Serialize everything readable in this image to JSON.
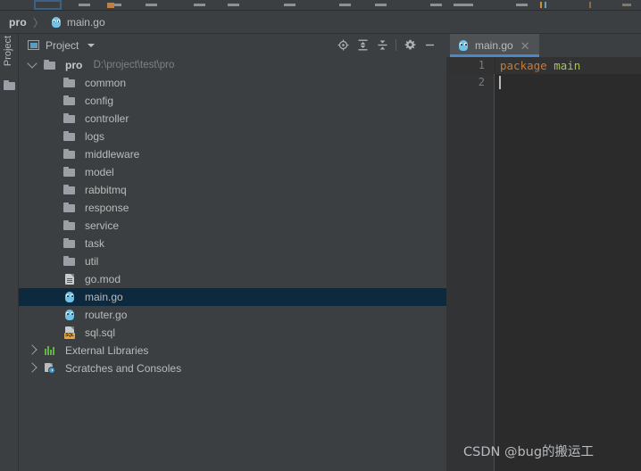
{
  "toolbar_strip": {
    "name": "cut-off-main-toolbar",
    "icon_positions": [
      5,
      40,
      75,
      110,
      145,
      180,
      215,
      250,
      285,
      320,
      355,
      390,
      425,
      460,
      495,
      530,
      565,
      600,
      635,
      670
    ],
    "accent_color": "#3d6185"
  },
  "breadcrumb": {
    "project": "pro",
    "separator": "〉",
    "file": "main.go",
    "file_icon": "go-gopher-icon"
  },
  "tool_strip": {
    "project_label": "Project",
    "folder_icon": "folder-icon"
  },
  "project_panel": {
    "header": {
      "icon": "project-view-icon",
      "title": "Project",
      "caret": "chevron-down-icon",
      "tools": [
        {
          "name": "select-opened-file-button",
          "icon": "crosshair-target-icon"
        },
        {
          "name": "expand-all-button",
          "icon": "expand-all-icon"
        },
        {
          "name": "collapse-all-button",
          "icon": "collapse-all-icon"
        },
        {
          "name": "settings-button",
          "icon": "gear-icon"
        },
        {
          "name": "hide-panel-button",
          "icon": "minimize-icon"
        }
      ]
    },
    "tree": [
      {
        "label": "pro",
        "path": "D:\\project\\test\\pro",
        "icon": "folder-icon",
        "indent": 0,
        "chevron": "down",
        "bold": true,
        "selected": false
      },
      {
        "label": "common",
        "path": "",
        "icon": "folder-icon",
        "indent": 1,
        "chevron": "",
        "bold": false,
        "selected": false
      },
      {
        "label": "config",
        "path": "",
        "icon": "folder-icon",
        "indent": 1,
        "chevron": "",
        "bold": false,
        "selected": false
      },
      {
        "label": "controller",
        "path": "",
        "icon": "folder-icon",
        "indent": 1,
        "chevron": "",
        "bold": false,
        "selected": false
      },
      {
        "label": "logs",
        "path": "",
        "icon": "folder-icon",
        "indent": 1,
        "chevron": "",
        "bold": false,
        "selected": false
      },
      {
        "label": "middleware",
        "path": "",
        "icon": "folder-icon",
        "indent": 1,
        "chevron": "",
        "bold": false,
        "selected": false
      },
      {
        "label": "model",
        "path": "",
        "icon": "folder-icon",
        "indent": 1,
        "chevron": "",
        "bold": false,
        "selected": false
      },
      {
        "label": "rabbitmq",
        "path": "",
        "icon": "folder-icon",
        "indent": 1,
        "chevron": "",
        "bold": false,
        "selected": false
      },
      {
        "label": "response",
        "path": "",
        "icon": "folder-icon",
        "indent": 1,
        "chevron": "",
        "bold": false,
        "selected": false
      },
      {
        "label": "service",
        "path": "",
        "icon": "folder-icon",
        "indent": 1,
        "chevron": "",
        "bold": false,
        "selected": false
      },
      {
        "label": "task",
        "path": "",
        "icon": "folder-icon",
        "indent": 1,
        "chevron": "",
        "bold": false,
        "selected": false
      },
      {
        "label": "util",
        "path": "",
        "icon": "folder-icon",
        "indent": 1,
        "chevron": "",
        "bold": false,
        "selected": false
      },
      {
        "label": "go.mod",
        "path": "",
        "icon": "go-mod-file-icon",
        "indent": 1,
        "chevron": "",
        "bold": false,
        "selected": false
      },
      {
        "label": "main.go",
        "path": "",
        "icon": "go-gopher-icon",
        "indent": 1,
        "chevron": "",
        "bold": false,
        "selected": true
      },
      {
        "label": "router.go",
        "path": "",
        "icon": "go-gopher-icon",
        "indent": 1,
        "chevron": "",
        "bold": false,
        "selected": false
      },
      {
        "label": "sql.sql",
        "path": "",
        "icon": "sql-file-icon",
        "indent": 1,
        "chevron": "",
        "bold": false,
        "selected": false
      },
      {
        "label": "External Libraries",
        "path": "",
        "icon": "external-libraries-icon",
        "indent": 0,
        "chevron": "right",
        "bold": false,
        "selected": false
      },
      {
        "label": "Scratches and Consoles",
        "path": "",
        "icon": "scratches-icon",
        "indent": 0,
        "chevron": "right",
        "bold": false,
        "selected": false
      }
    ],
    "selection_color": "#0d293e"
  },
  "editor": {
    "tab": {
      "label": "main.go",
      "icon": "go-gopher-icon",
      "close_icon": "close-icon",
      "active_underline_color": "#4a88c7"
    },
    "line_numbers": [
      "1",
      "2"
    ],
    "code": {
      "line1_keyword": "package",
      "line1_identifier": "main",
      "line2": ""
    },
    "keyword_color": "#cc7832",
    "identifier_color": "#a5c261",
    "background": "#2b2b2b"
  },
  "watermark": {
    "text": "CSDN @bug的搬运工"
  }
}
